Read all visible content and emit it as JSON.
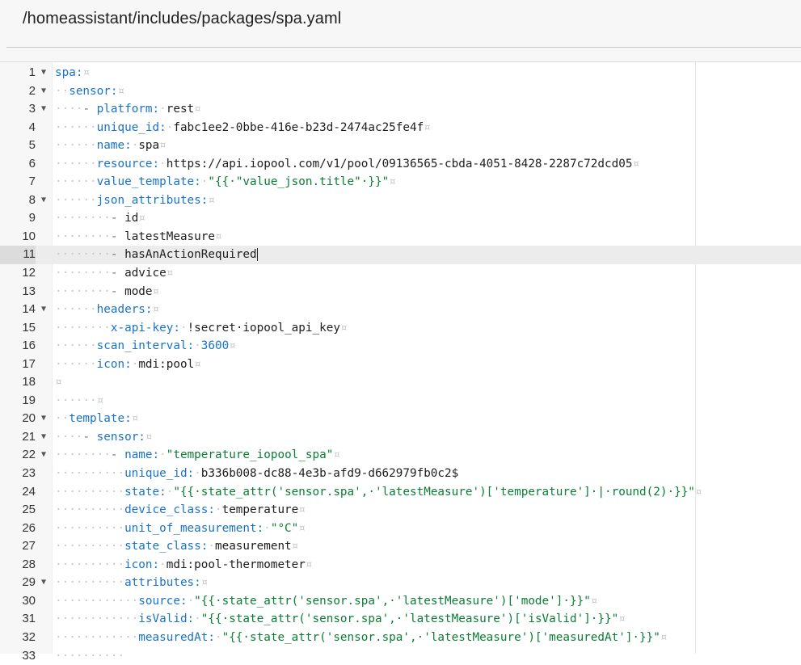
{
  "header": {
    "file_path": "/homeassistant/includes/packages/spa.yaml"
  },
  "editor": {
    "active_line": 11,
    "lines": [
      {
        "n": "1",
        "fold": true,
        "tokens": [
          [
            "k",
            "spa:"
          ],
          [
            "ws",
            "¤"
          ]
        ]
      },
      {
        "n": "2",
        "fold": true,
        "tokens": [
          [
            "ws",
            "··"
          ],
          [
            "k",
            "sensor:"
          ],
          [
            "ws",
            "¤"
          ]
        ]
      },
      {
        "n": "3",
        "fold": true,
        "tokens": [
          [
            "ws",
            "····"
          ],
          [
            "p",
            "- "
          ],
          [
            "k",
            "platform:"
          ],
          [
            "ws",
            "·"
          ],
          [
            "t",
            "rest"
          ],
          [
            "ws",
            "¤"
          ]
        ]
      },
      {
        "n": "4",
        "fold": false,
        "tokens": [
          [
            "ws",
            "······"
          ],
          [
            "k",
            "unique_id:"
          ],
          [
            "ws",
            "·"
          ],
          [
            "t",
            "fabc1ee2-0bbe-416e-b23d-2474ac25fe4f"
          ],
          [
            "ws",
            "¤"
          ]
        ]
      },
      {
        "n": "5",
        "fold": false,
        "tokens": [
          [
            "ws",
            "······"
          ],
          [
            "k",
            "name:"
          ],
          [
            "ws",
            "·"
          ],
          [
            "t",
            "spa"
          ],
          [
            "ws",
            "¤"
          ]
        ]
      },
      {
        "n": "6",
        "fold": false,
        "tokens": [
          [
            "ws",
            "······"
          ],
          [
            "k",
            "resource:"
          ],
          [
            "ws",
            "·"
          ],
          [
            "t",
            "https://api.iopool.com/v1/pool/09136565-cbda-4051-8428-2287c72dcd05"
          ],
          [
            "ws",
            "¤"
          ]
        ]
      },
      {
        "n": "7",
        "fold": false,
        "tokens": [
          [
            "ws",
            "······"
          ],
          [
            "k",
            "value_template:"
          ],
          [
            "ws",
            "·"
          ],
          [
            "s",
            "\"{{·\"value_json.title\"·}}\""
          ],
          [
            "ws",
            "¤"
          ]
        ]
      },
      {
        "n": "8",
        "fold": true,
        "tokens": [
          [
            "ws",
            "······"
          ],
          [
            "k",
            "json_attributes:"
          ],
          [
            "ws",
            "¤"
          ]
        ]
      },
      {
        "n": "9",
        "fold": false,
        "tokens": [
          [
            "ws",
            "········"
          ],
          [
            "p",
            "- "
          ],
          [
            "t",
            "id"
          ],
          [
            "ws",
            "¤"
          ]
        ]
      },
      {
        "n": "10",
        "fold": false,
        "tokens": [
          [
            "ws",
            "········"
          ],
          [
            "p",
            "- "
          ],
          [
            "t",
            "latestMeasure"
          ],
          [
            "ws",
            "¤"
          ]
        ]
      },
      {
        "n": "11",
        "fold": false,
        "tokens": [
          [
            "ws",
            "········"
          ],
          [
            "p",
            "- "
          ],
          [
            "t",
            "hasAnActionRequired"
          ],
          [
            "cursor",
            ""
          ]
        ]
      },
      {
        "n": "12",
        "fold": false,
        "tokens": [
          [
            "ws",
            "········"
          ],
          [
            "p",
            "- "
          ],
          [
            "t",
            "advice"
          ],
          [
            "ws",
            "¤"
          ]
        ]
      },
      {
        "n": "13",
        "fold": false,
        "tokens": [
          [
            "ws",
            "········"
          ],
          [
            "p",
            "- "
          ],
          [
            "t",
            "mode"
          ],
          [
            "ws",
            "¤"
          ]
        ]
      },
      {
        "n": "14",
        "fold": true,
        "tokens": [
          [
            "ws",
            "······"
          ],
          [
            "k",
            "headers:"
          ],
          [
            "ws",
            "¤"
          ]
        ]
      },
      {
        "n": "15",
        "fold": false,
        "tokens": [
          [
            "ws",
            "········"
          ],
          [
            "k",
            "x-api-key:"
          ],
          [
            "ws",
            "·"
          ],
          [
            "t",
            "!secret·iopool_api_key"
          ],
          [
            "ws",
            "¤"
          ]
        ]
      },
      {
        "n": "16",
        "fold": false,
        "tokens": [
          [
            "ws",
            "······"
          ],
          [
            "k",
            "scan_interval:"
          ],
          [
            "ws",
            "·"
          ],
          [
            "k",
            "3600"
          ],
          [
            "ws",
            "¤"
          ]
        ]
      },
      {
        "n": "17",
        "fold": false,
        "tokens": [
          [
            "ws",
            "······"
          ],
          [
            "k",
            "icon:"
          ],
          [
            "ws",
            "·"
          ],
          [
            "t",
            "mdi:pool"
          ],
          [
            "ws",
            "¤"
          ]
        ]
      },
      {
        "n": "18",
        "fold": false,
        "tokens": [
          [
            "ws",
            "¤"
          ]
        ]
      },
      {
        "n": "19",
        "fold": false,
        "tokens": [
          [
            "ws",
            "······¤"
          ]
        ]
      },
      {
        "n": "20",
        "fold": true,
        "tokens": [
          [
            "ws",
            "··"
          ],
          [
            "k",
            "template:"
          ],
          [
            "ws",
            "¤"
          ]
        ]
      },
      {
        "n": "21",
        "fold": true,
        "tokens": [
          [
            "ws",
            "····"
          ],
          [
            "p",
            "- "
          ],
          [
            "k",
            "sensor:"
          ],
          [
            "ws",
            "¤"
          ]
        ]
      },
      {
        "n": "22",
        "fold": true,
        "tokens": [
          [
            "ws",
            "········"
          ],
          [
            "p",
            "- "
          ],
          [
            "k",
            "name:"
          ],
          [
            "ws",
            "·"
          ],
          [
            "s",
            "\"temperature_iopool_spa\""
          ],
          [
            "ws",
            "¤"
          ]
        ]
      },
      {
        "n": "23",
        "fold": false,
        "tokens": [
          [
            "ws",
            "··········"
          ],
          [
            "k",
            "unique_id:"
          ],
          [
            "ws",
            "·"
          ],
          [
            "t",
            "b336b008-dc88-4e3b-afd9-d662979fb0c2$"
          ]
        ]
      },
      {
        "n": "24",
        "fold": false,
        "tokens": [
          [
            "ws",
            "··········"
          ],
          [
            "k",
            "state:"
          ],
          [
            "ws",
            "·"
          ],
          [
            "s",
            "\"{{·state_attr('sensor.spa',·'latestMeasure')['temperature']·|·round(2)·}}\""
          ],
          [
            "ws",
            "¤"
          ]
        ]
      },
      {
        "n": "25",
        "fold": false,
        "tokens": [
          [
            "ws",
            "··········"
          ],
          [
            "k",
            "device_class:"
          ],
          [
            "ws",
            "·"
          ],
          [
            "t",
            "temperature"
          ],
          [
            "ws",
            "¤"
          ]
        ]
      },
      {
        "n": "26",
        "fold": false,
        "tokens": [
          [
            "ws",
            "··········"
          ],
          [
            "k",
            "unit_of_measurement:"
          ],
          [
            "ws",
            "·"
          ],
          [
            "s",
            "\"°C\""
          ],
          [
            "ws",
            "¤"
          ]
        ]
      },
      {
        "n": "27",
        "fold": false,
        "tokens": [
          [
            "ws",
            "··········"
          ],
          [
            "k",
            "state_class:"
          ],
          [
            "ws",
            "·"
          ],
          [
            "t",
            "measurement"
          ],
          [
            "ws",
            "¤"
          ]
        ]
      },
      {
        "n": "28",
        "fold": false,
        "tokens": [
          [
            "ws",
            "··········"
          ],
          [
            "k",
            "icon:"
          ],
          [
            "ws",
            "·"
          ],
          [
            "t",
            "mdi:pool-thermometer"
          ],
          [
            "ws",
            "¤"
          ]
        ]
      },
      {
        "n": "29",
        "fold": true,
        "tokens": [
          [
            "ws",
            "··········"
          ],
          [
            "k",
            "attributes:"
          ],
          [
            "ws",
            "¤"
          ]
        ]
      },
      {
        "n": "30",
        "fold": false,
        "tokens": [
          [
            "ws",
            "············"
          ],
          [
            "k",
            "source:"
          ],
          [
            "ws",
            "·"
          ],
          [
            "s",
            "\"{{·state_attr('sensor.spa',·'latestMeasure')['mode']·}}\""
          ],
          [
            "ws",
            "¤"
          ]
        ]
      },
      {
        "n": "31",
        "fold": false,
        "tokens": [
          [
            "ws",
            "············"
          ],
          [
            "k",
            "isValid:"
          ],
          [
            "ws",
            "·"
          ],
          [
            "s",
            "\"{{·state_attr('sensor.spa',·'latestMeasure')['isValid']·}}\""
          ],
          [
            "ws",
            "¤"
          ]
        ]
      },
      {
        "n": "32",
        "fold": false,
        "tokens": [
          [
            "ws",
            "············"
          ],
          [
            "k",
            "measuredAt:"
          ],
          [
            "ws",
            "·"
          ],
          [
            "s",
            "\"{{·state_attr('sensor.spa',·'latestMeasure')['measuredAt']·}}\""
          ],
          [
            "ws",
            "¤"
          ]
        ]
      },
      {
        "n": "33",
        "fold": false,
        "tokens": [
          [
            "ws",
            "··········"
          ]
        ]
      }
    ]
  }
}
